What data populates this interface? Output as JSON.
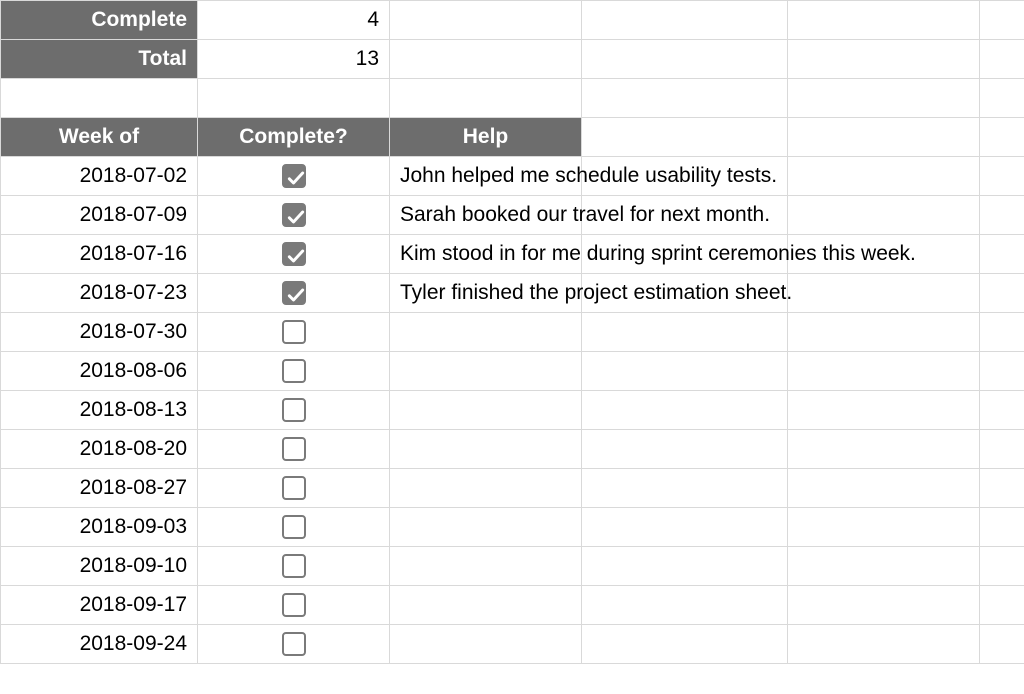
{
  "summary": {
    "complete_label": "Complete",
    "complete_value": "4",
    "total_label": "Total",
    "total_value": "13"
  },
  "headers": {
    "week_of": "Week of",
    "complete": "Complete?",
    "help": "Help"
  },
  "rows": [
    {
      "date": "2018-07-02",
      "checked": true,
      "help": "John helped me schedule usability tests."
    },
    {
      "date": "2018-07-09",
      "checked": true,
      "help": "Sarah booked our travel for next month."
    },
    {
      "date": "2018-07-16",
      "checked": true,
      "help": "Kim stood in for me during sprint ceremonies this week."
    },
    {
      "date": "2018-07-23",
      "checked": true,
      "help": "Tyler finished the project estimation sheet."
    },
    {
      "date": "2018-07-30",
      "checked": false,
      "help": ""
    },
    {
      "date": "2018-08-06",
      "checked": false,
      "help": ""
    },
    {
      "date": "2018-08-13",
      "checked": false,
      "help": ""
    },
    {
      "date": "2018-08-20",
      "checked": false,
      "help": ""
    },
    {
      "date": "2018-08-27",
      "checked": false,
      "help": ""
    },
    {
      "date": "2018-09-03",
      "checked": false,
      "help": ""
    },
    {
      "date": "2018-09-10",
      "checked": false,
      "help": ""
    },
    {
      "date": "2018-09-17",
      "checked": false,
      "help": ""
    },
    {
      "date": "2018-09-24",
      "checked": false,
      "help": ""
    }
  ]
}
